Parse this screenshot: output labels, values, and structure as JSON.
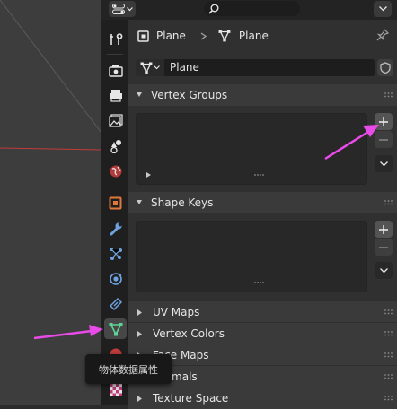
{
  "breadcrumb": {
    "object_name": "Plane",
    "mesh_name": "Plane"
  },
  "mesh_datablock": {
    "name": "Plane"
  },
  "panels": {
    "vertex_groups": "Vertex Groups",
    "shape_keys": "Shape Keys",
    "uv_maps": "UV Maps",
    "vertex_colors": "Vertex Colors",
    "face_maps": "Face Maps",
    "normals": "Normals",
    "texture_space": "Texture Space"
  },
  "buttons": {
    "add": "+",
    "remove": "−"
  },
  "tooltip": {
    "text": "物体数据属性"
  },
  "colors": {
    "accent_green": "#5fd497",
    "annotation_arrow": "#e84be8",
    "object_orange": "#e0783a",
    "wrench_blue": "#6ea3e0",
    "viewport_red_line": "#c23a3a"
  },
  "icons": {
    "editor_type": "editor-properties-icon",
    "search": "search-icon",
    "pin": "pin-icon",
    "object": "object-icon",
    "mesh": "mesh-data-icon",
    "fake_user": "shield-icon"
  }
}
